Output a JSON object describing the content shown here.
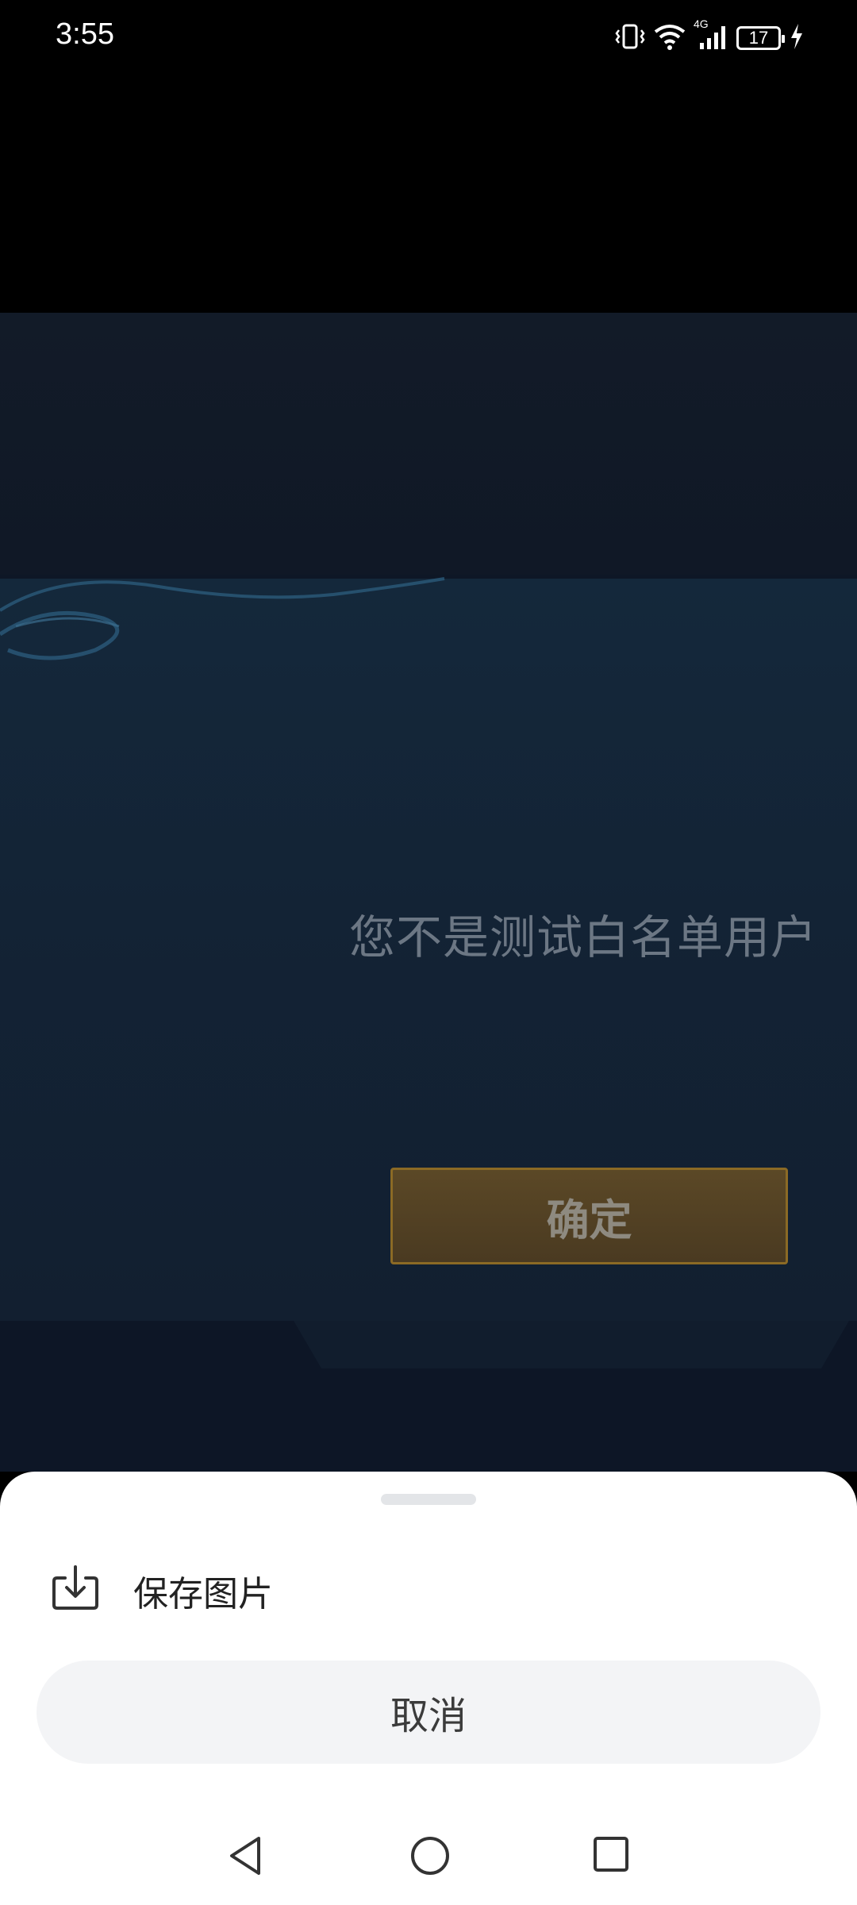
{
  "status_bar": {
    "time": "3:55",
    "battery_level": "17",
    "network_label": "4G",
    "icons": [
      "vibrate-icon",
      "wifi-icon",
      "signal-icon",
      "battery-icon",
      "charging-icon"
    ]
  },
  "photo": {
    "dialog_message": "您不是测试白名单用户",
    "confirm_label": "确定"
  },
  "sheet": {
    "save_label": "保存图片",
    "save_icon": "download-icon",
    "cancel_label": "取消"
  },
  "nav": {
    "icons": [
      "back-icon",
      "home-icon",
      "recents-icon"
    ]
  }
}
